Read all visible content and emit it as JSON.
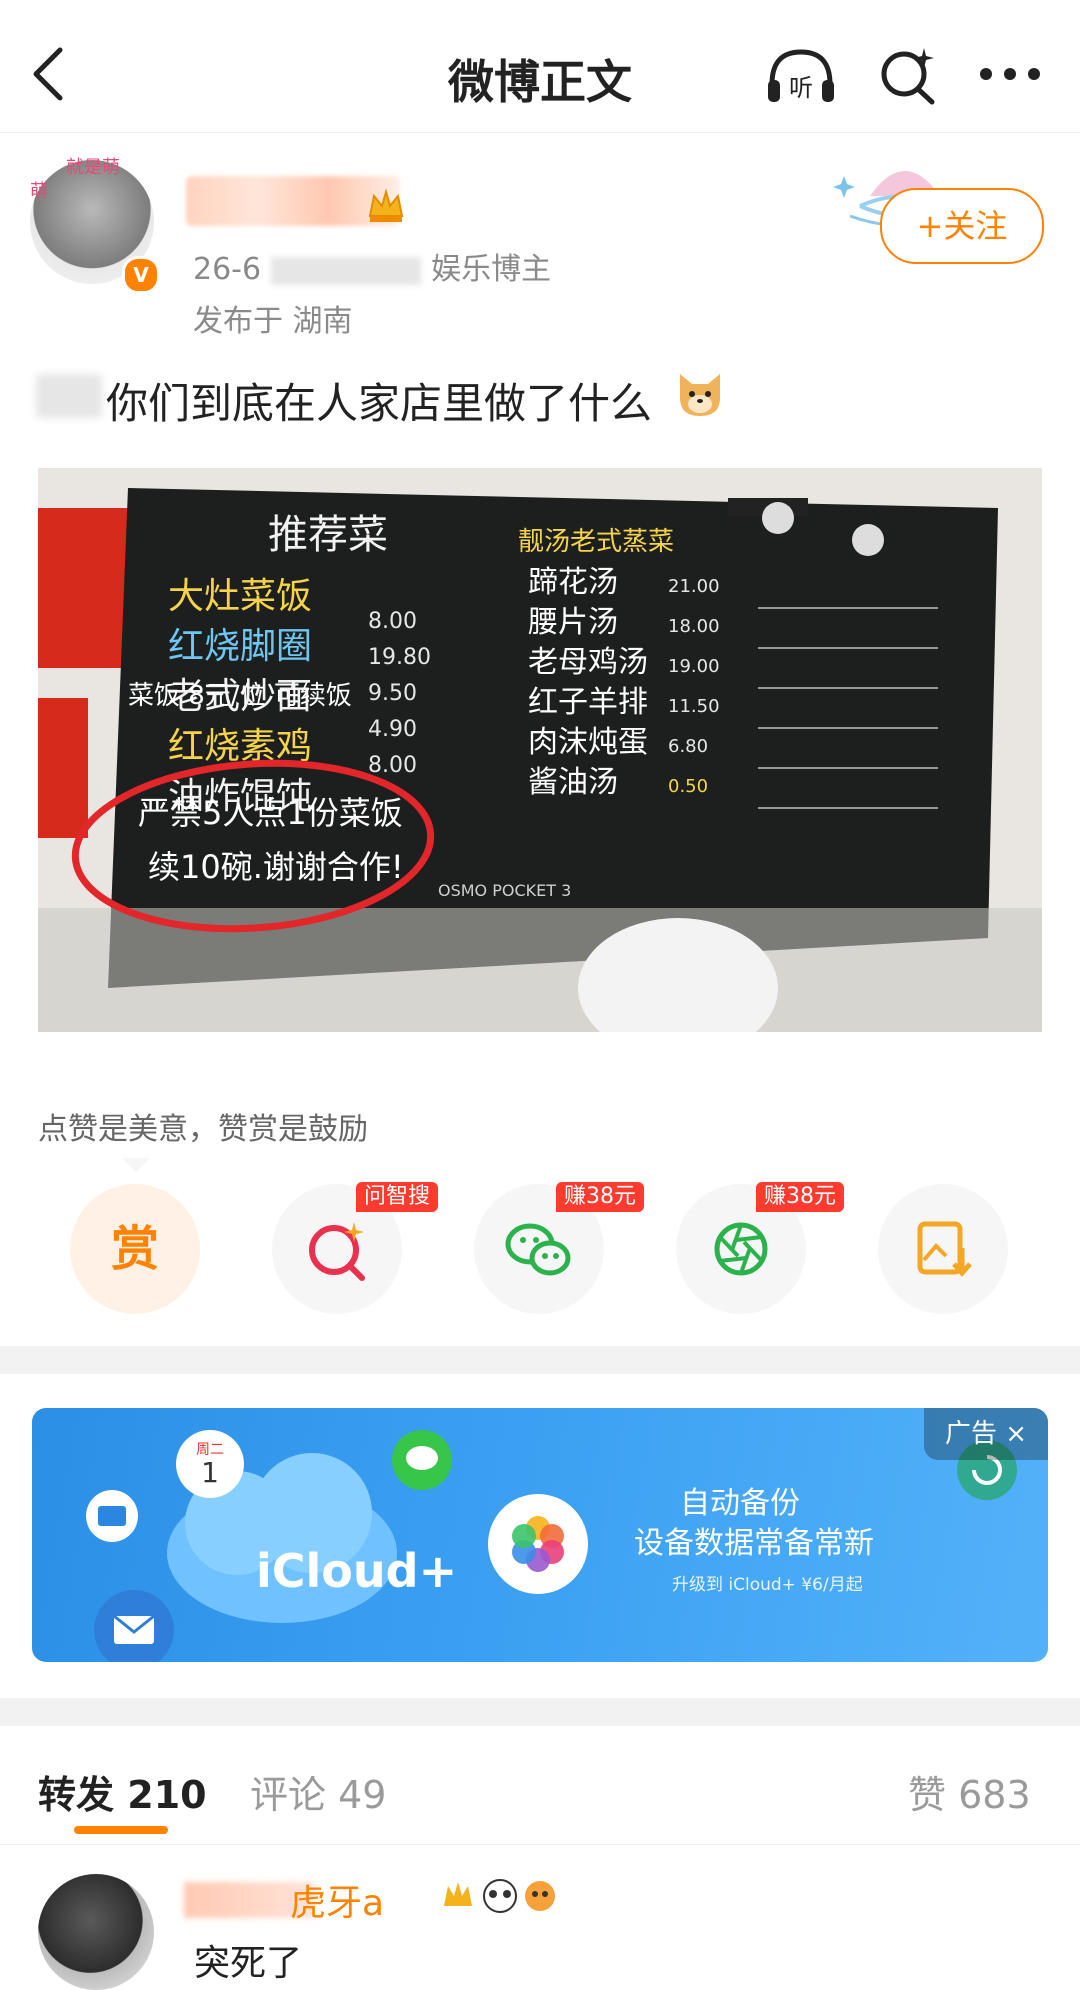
{
  "header": {
    "title": "微博正文",
    "listen_label": "听"
  },
  "post": {
    "avatar_tags": [
      "就是萌",
      "萌"
    ],
    "verified_mark": "V",
    "date_prefix": "26-6",
    "role": "娱乐博主",
    "location": "发布于 湖南",
    "follow_label": "+关注",
    "text": "你们到底在人家店里做了什么"
  },
  "menu_image": {
    "board_title": "推荐菜",
    "columns": [
      "大灶菜饭",
      "红烧脚圈",
      "老式炒面",
      "红烧素鸡",
      "油炸馄饨"
    ],
    "prices": [
      "8.00",
      "19.80",
      "9.50",
      "4.90",
      "8.00"
    ],
    "line1": "菜饭 8元/位 可续饭",
    "notice_line1": "严禁5人点1份菜饭",
    "notice_line2": "续10碗.谢谢合作!",
    "soup_title": "靓汤老式蒸菜",
    "soups": [
      "蹄花汤",
      "腰片汤",
      "老母鸡汤",
      "红子羊排",
      "肉沫炖蛋",
      "酱油汤"
    ],
    "soup_prices": [
      "21.00",
      "18.00",
      "19.00",
      "11.50",
      "6.80",
      "0.50"
    ],
    "watermark": "OSMO POCKET 3"
  },
  "reward": {
    "caption": "点赞是美意，赞赏是鼓励",
    "reward_char": "赏",
    "badges": [
      "问智搜",
      "赚38元",
      "赚38元"
    ]
  },
  "ad": {
    "tag": "广告",
    "close": "×",
    "calendar_day": "周二",
    "calendar_date": "1",
    "brand": "iCloud+",
    "line1": "自动备份",
    "line2": "设备数据常备常新",
    "price": "升级到 iCloud+ ¥6/月起"
  },
  "tabs": {
    "forward_label": "转发",
    "forward_count": "210",
    "comment_label": "评论",
    "comment_count": "49",
    "like_label": "赞",
    "like_count": "683"
  },
  "forward_item": {
    "name_suffix": "虎牙a",
    "text": "突死了"
  },
  "colors": {
    "accent": "#ff8200",
    "badge_red": "#ff3b30",
    "ad_blue": "#3fa3f4"
  }
}
